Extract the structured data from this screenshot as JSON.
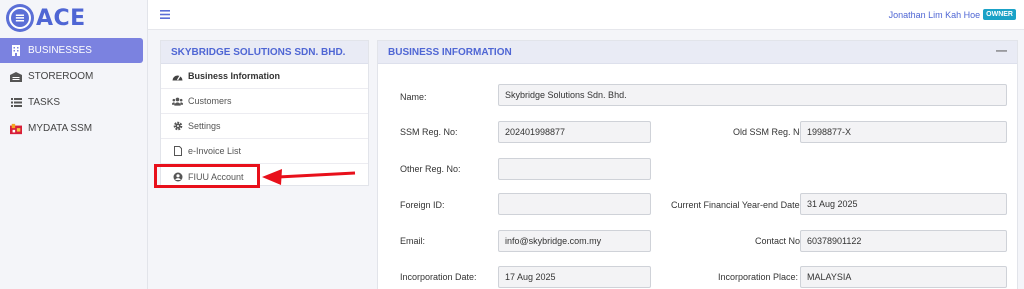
{
  "app": {
    "logo_text": "ACE",
    "logo_mark": "≡"
  },
  "sidebar": {
    "items": [
      {
        "label": "BUSINESSES",
        "icon": "building-icon",
        "active": true
      },
      {
        "label": "STOREROOM",
        "icon": "warehouse-icon",
        "active": false
      },
      {
        "label": "TASKS",
        "icon": "list-icon",
        "active": false
      },
      {
        "label": "MYDATA SSM",
        "icon": "mydata-ssm-logo-icon",
        "active": false
      }
    ]
  },
  "topbar": {
    "user_name": "Jonathan Lim Kah Hoe",
    "role_badge": "OWNER"
  },
  "business_menu": {
    "title": "SKYBRIDGE SOLUTIONS SDN. BHD.",
    "items": [
      {
        "label": "Business Information",
        "icon": "dashboard-icon"
      },
      {
        "label": "Customers",
        "icon": "users-icon"
      },
      {
        "label": "Settings",
        "icon": "gear-icon"
      },
      {
        "label": "e-Invoice List",
        "icon": "document-icon"
      },
      {
        "label": "FIUU Account",
        "icon": "user-circle-icon"
      }
    ]
  },
  "business_info": {
    "title": "BUSINESS INFORMATION",
    "minimize_glyph": "—",
    "name_label": "Name:",
    "name_value": "Skybridge Solutions Sdn. Bhd.",
    "ssm_label": "SSM Reg. No:",
    "ssm_value": "202401998877",
    "old_ssm_label": "Old SSM Reg. No:",
    "old_ssm_value": "1998877-X",
    "other_reg_label": "Other Reg. No:",
    "other_reg_value": "",
    "foreign_id_label": "Foreign ID:",
    "foreign_id_value": "",
    "fy_end_label": "Current Financial Year-end Date:",
    "fy_end_value": "31 Aug 2025",
    "email_label": "Email:",
    "email_value": "info@skybridge.com.my",
    "contact_label": "Contact No:",
    "contact_value": "60378901122",
    "inc_date_label": "Incorporation Date:",
    "inc_date_value": "17 Aug 2025",
    "inc_place_label": "Incorporation Place:",
    "inc_place_value": "MALAYSIA"
  },
  "annotation": {
    "color": "#e8101b"
  }
}
